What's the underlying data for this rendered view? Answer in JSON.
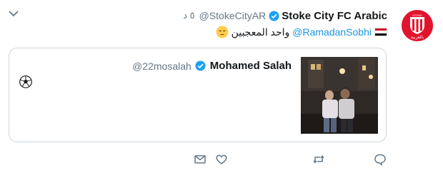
{
  "tweet": {
    "display_name": "Stoke City FC Arabic",
    "handle": "@StokeCityAR",
    "time": "٥ د",
    "body_mention": "@RamadanSobhi",
    "body_text": "واحد المعجبين",
    "avatar_text": "بالعربية",
    "avatar_badge": "STOKE"
  },
  "quoted": {
    "display_name": "Mohamed Salah",
    "handle": "@22mosalah"
  },
  "icons": {
    "menu": "chevron-down-icon",
    "verified": "verified-badge-icon",
    "flag": "egypt-flag-emoji",
    "pensive": "pensive-face-emoji",
    "soccer": "soccer-ball-emoji",
    "reply": "reply-icon",
    "retweet": "retweet-icon",
    "like": "heart-icon",
    "dm": "envelope-icon"
  },
  "colors": {
    "brand_red": "#e2142d",
    "link_blue": "#1b95e0",
    "secondary_gray": "#657786"
  }
}
